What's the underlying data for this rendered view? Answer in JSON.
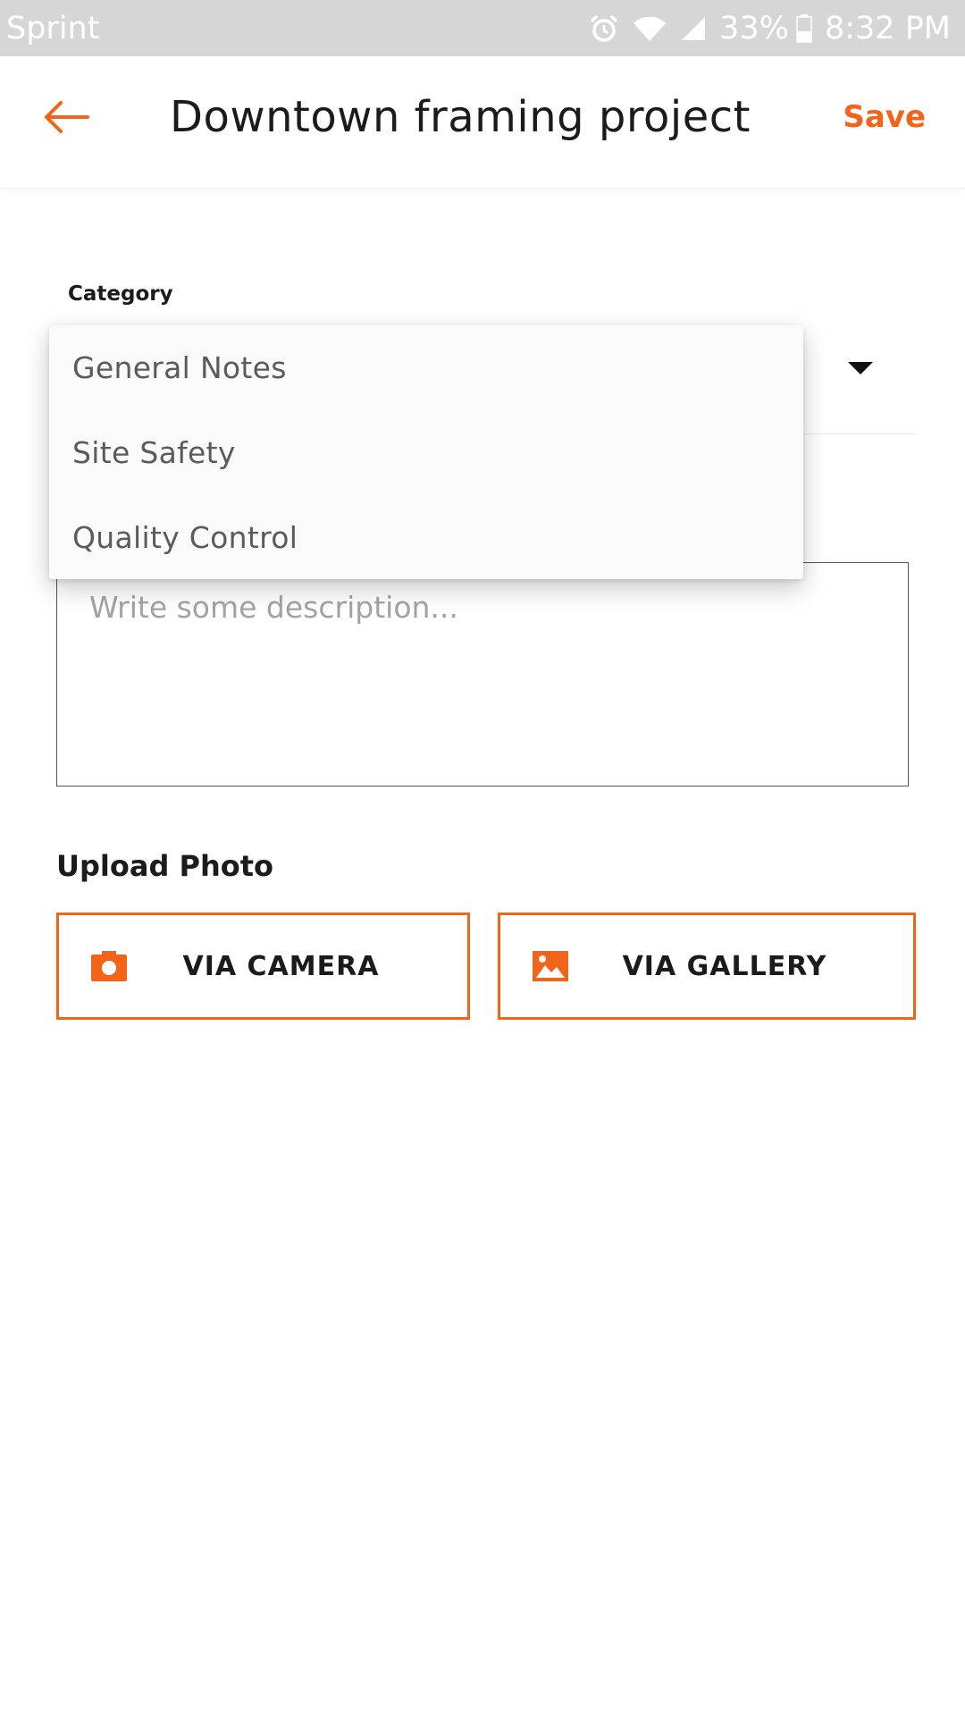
{
  "status_bar": {
    "carrier": "Sprint",
    "battery": "33%",
    "time": "8:32 PM",
    "icons": [
      "alarm-icon",
      "wifi-icon",
      "signal-icon",
      "battery-icon"
    ]
  },
  "app_bar": {
    "title": "Downtown framing project",
    "save_label": "Save",
    "back_icon": "arrow-left-icon"
  },
  "form": {
    "category_label": "Category",
    "category_options": [
      "General Notes",
      "Site Safety",
      "Quality Control"
    ],
    "description_placeholder": "Write some description...",
    "upload_label": "Upload Photo",
    "camera_button": "VIA CAMERA",
    "gallery_button": "VIA GALLERY"
  },
  "colors": {
    "accent": "#f26419",
    "status_bar": "#d6d6d6",
    "menu_background": "#fafafa",
    "text": "#1b1b1b",
    "placeholder": "#a3a3a3"
  }
}
